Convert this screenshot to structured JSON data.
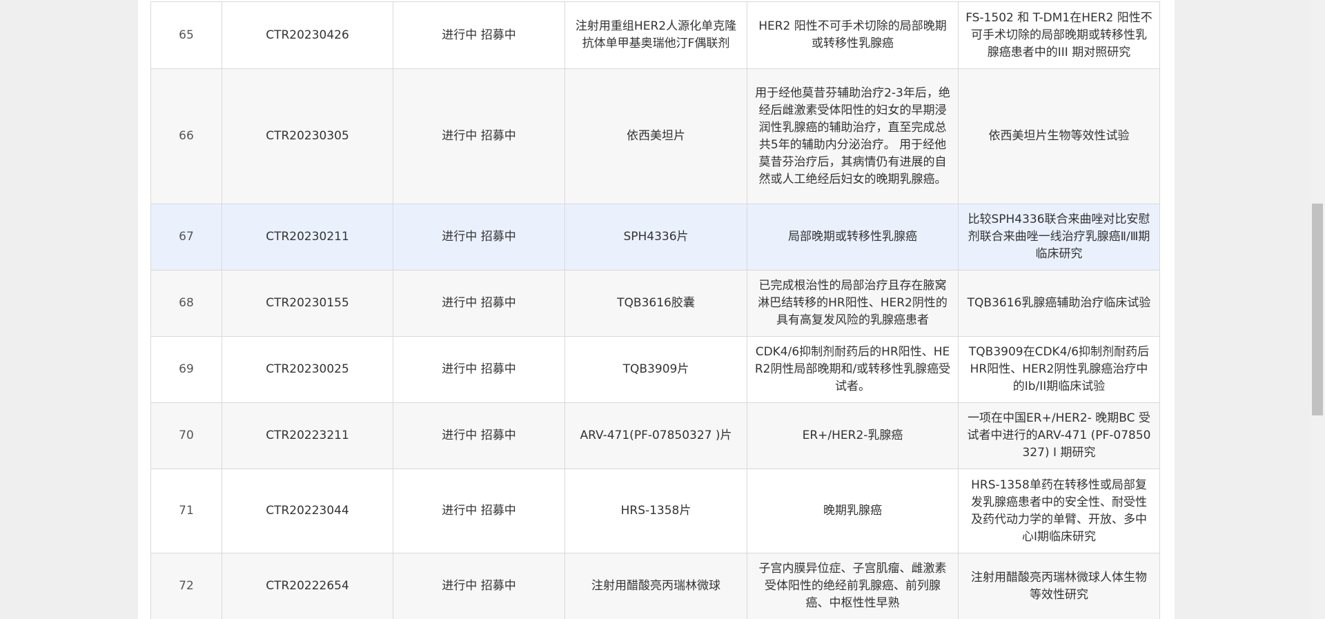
{
  "rows": [
    {
      "no": "65",
      "id": "CTR20230426",
      "status": "进行中 招募中",
      "drug": "注射用重组HER2人源化单克隆抗体单甲基奥瑞他汀F偶联剂",
      "indication": "HER2 阳性不可手术切除的局部晚期或转移性乳腺癌",
      "title": "FS-1502 和 T-DM1在HER2 阳性不可手术切除的局部晚期或转移性乳腺癌患者中的III 期对照研究"
    },
    {
      "no": "66",
      "id": "CTR20230305",
      "status": "进行中 招募中",
      "drug": "依西美坦片",
      "indication": "用于经他莫昔芬辅助治疗2-3年后，绝经后雌激素受体阳性的妇女的早期浸润性乳腺癌的辅助治疗，直至完成总共5年的辅助内分泌治疗。 用于经他莫昔芬治疗后，其病情仍有进展的自然或人工绝经后妇女的晚期乳腺癌。",
      "title": "依西美坦片生物等效性试验"
    },
    {
      "no": "67",
      "id": "CTR20230211",
      "status": "进行中 招募中",
      "drug": "SPH4336片",
      "indication": "局部晚期或转移性乳腺癌",
      "title": "比较SPH4336联合来曲唑对比安慰剂联合来曲唑一线治疗乳腺癌Ⅱ/Ⅲ期临床研究"
    },
    {
      "no": "68",
      "id": "CTR20230155",
      "status": "进行中 招募中",
      "drug": "TQB3616胶囊",
      "indication": "已完成根治性的局部治疗且存在腋窝淋巴结转移的HR阳性、HER2阴性的具有高复发风险的乳腺癌患者",
      "title": "TQB3616乳腺癌辅助治疗临床试验"
    },
    {
      "no": "69",
      "id": "CTR20230025",
      "status": "进行中 招募中",
      "drug": "TQB3909片",
      "indication": "CDK4/6抑制剂耐药后的HR阳性、HER2阴性局部晚期和/或转移性乳腺癌受试者。",
      "title": "TQB3909在CDK4/6抑制剂耐药后HR阳性、HER2阴性乳腺癌治疗中的Ib/II期临床试验"
    },
    {
      "no": "70",
      "id": "CTR20223211",
      "status": "进行中 招募中",
      "drug": "ARV-471(PF-07850327 )片",
      "indication": "ER+/HER2-乳腺癌",
      "title": "一项在中国ER+/HER2- 晚期BC 受试者中进行的ARV-471 (PF-07850327) I 期研究"
    },
    {
      "no": "71",
      "id": "CTR20223044",
      "status": "进行中 招募中",
      "drug": "HRS-1358片",
      "indication": "晚期乳腺癌",
      "title": "HRS-1358单药在转移性或局部复发乳腺癌患者中的安全性、耐受性及药代动力学的单臂、开放、多中心I期临床研究"
    },
    {
      "no": "72",
      "id": "CTR20222654",
      "status": "进行中 招募中",
      "drug": "注射用醋酸亮丙瑞林微球",
      "indication": "子宫内膜异位症、子宫肌瘤、雌激素受体阳性的绝经前乳腺癌、前列腺癌、中枢性性早熟",
      "title": "注射用醋酸亮丙瑞林微球人体生物等效性研究"
    }
  ]
}
